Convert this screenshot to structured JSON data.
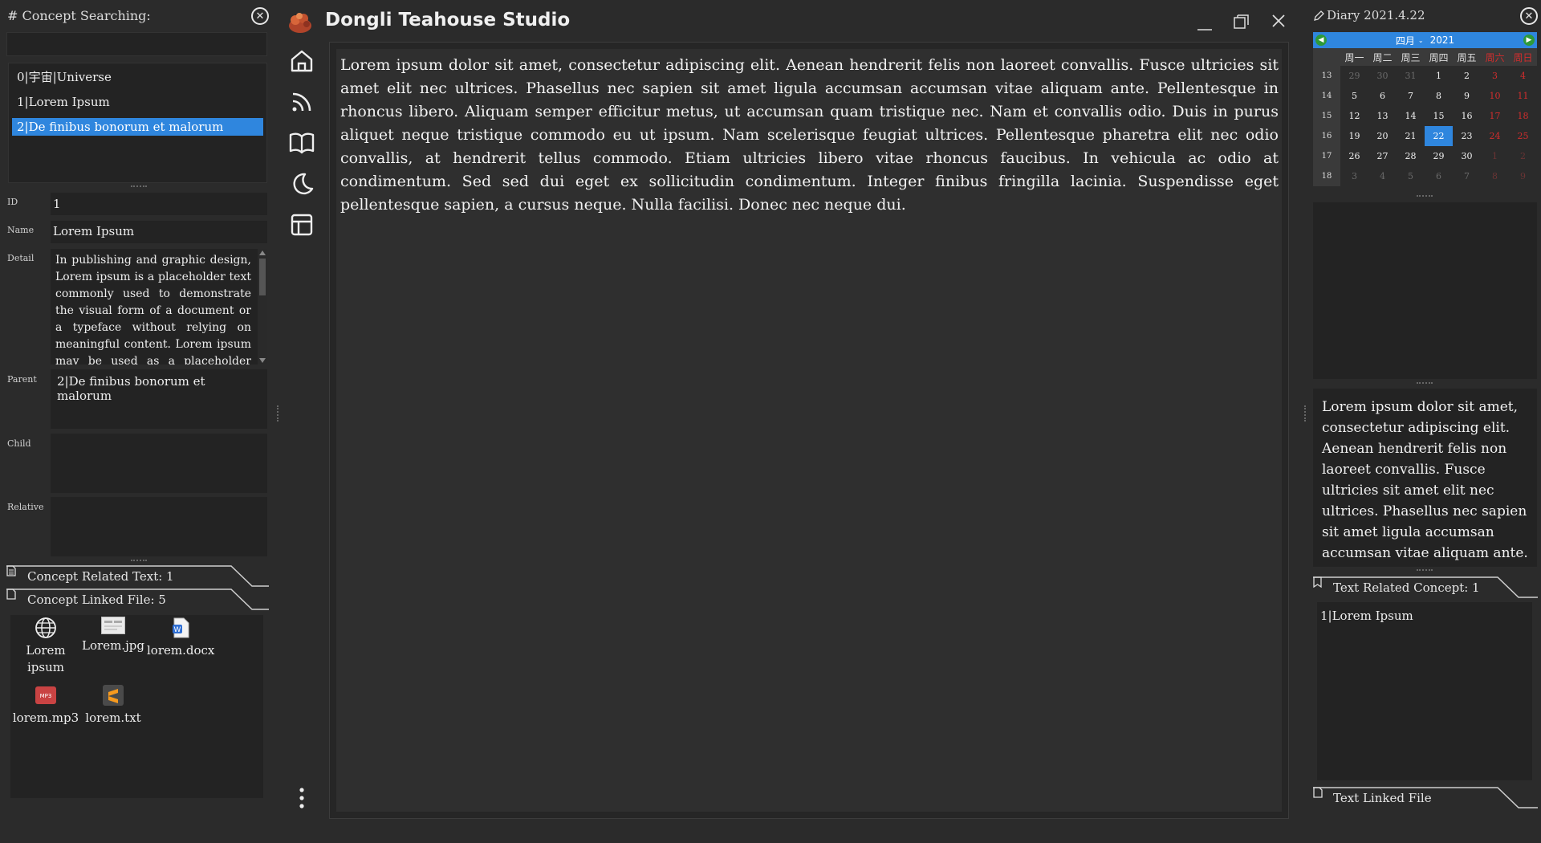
{
  "left_panel": {
    "title": "# Concept Searching:",
    "search_value": "",
    "concepts": [
      {
        "label": "0|宇宙|Universe",
        "selected": false
      },
      {
        "label": "1|Lorem Ipsum",
        "selected": false
      },
      {
        "label": "2|De finibus bonorum et malorum",
        "selected": true
      }
    ],
    "fields": {
      "id_label": "ID",
      "id_value": "1",
      "name_label": "Name",
      "name_value": "Lorem Ipsum",
      "detail_label": "Detail",
      "detail_value": "In publishing and graphic design, Lorem ipsum is a placeholder text commonly used to demonstrate the visual form of a document or a typeface without relying on meaningful content. Lorem ipsum may be used as a placeholder before final copy is available.",
      "parent_label": "Parent",
      "parent_value": "2|De finibus bonorum et malorum",
      "child_label": "Child",
      "child_value": "",
      "relative_label": "Relative",
      "relative_value": ""
    },
    "related_text_tab": "Concept Related Text: 1",
    "linked_file_tab": "Concept Linked File: 5",
    "files": [
      {
        "name": "Lorem ipsum",
        "icon": "globe-icon"
      },
      {
        "name": "Lorem.jpg",
        "icon": "image-icon"
      },
      {
        "name": "lorem.docx",
        "icon": "word-doc-icon"
      },
      {
        "name": "lorem.mp3",
        "icon": "mp3-icon"
      },
      {
        "name": "lorem.txt",
        "icon": "sublime-text-icon"
      }
    ]
  },
  "app": {
    "title": "Dongli Teahouse Studio",
    "logo_icon": "teahouse-logo-icon",
    "window_buttons": [
      "minimize-icon",
      "restore-icon",
      "close-icon"
    ],
    "nav_icons": [
      "home-icon",
      "rss-icon",
      "book-icon",
      "moon-icon",
      "layout-icon"
    ],
    "more_icon": "more-vertical-icon"
  },
  "editor": {
    "text": "Lorem ipsum dolor sit amet, consectetur adipiscing elit. Aenean hendrerit felis non laoreet convallis. Fusce ultricies sit amet elit nec ultrices. Phasellus nec sapien sit amet ligula accumsan accumsan vitae aliquam ante. Pellentesque in rhoncus libero. Aliquam semper efficitur metus, ut accumsan quam tristique nec. Nam et convallis odio. Duis in purus aliquet neque tristique commodo eu ut ipsum. Nam scelerisque feugiat ultrices. Pellentesque pharetra elit nec odio convallis, at hendrerit tellus commodo. Etiam ultricies libero vitae rhoncus faucibus. In vehicula ac odio at condimentum. Sed sed dui eget ex sollicitudin condimentum. Integer finibus fringilla lacinia. Suspendisse eget pellentesque sapien, a cursus neque. Nulla facilisi. Donec nec neque dui."
  },
  "right_panel": {
    "title": "Diary 2021.4.22",
    "calendar": {
      "month": "四月",
      "year": "2021",
      "weekdays": [
        "周一",
        "周二",
        "周三",
        "周四",
        "周五",
        "周六",
        "周日"
      ],
      "weeks": [
        {
          "week": "13",
          "days": [
            "29",
            "30",
            "31",
            "1",
            "2",
            "3",
            "4"
          ]
        },
        {
          "week": "14",
          "days": [
            "5",
            "6",
            "7",
            "8",
            "9",
            "10",
            "11"
          ]
        },
        {
          "week": "15",
          "days": [
            "12",
            "13",
            "14",
            "15",
            "16",
            "17",
            "18"
          ]
        },
        {
          "week": "16",
          "days": [
            "19",
            "20",
            "21",
            "22",
            "23",
            "24",
            "25"
          ]
        },
        {
          "week": "17",
          "days": [
            "26",
            "27",
            "28",
            "29",
            "30",
            "1",
            "2"
          ]
        },
        {
          "week": "18",
          "days": [
            "3",
            "4",
            "5",
            "6",
            "7",
            "8",
            "9"
          ]
        }
      ],
      "today": "22",
      "accent_color": "#2f86de",
      "weekend_color": "#d12d2d"
    },
    "note_text": "Lorem ipsum dolor sit amet, consectetur adipiscing elit. Aenean hendrerit felis non laoreet convallis. Fusce ultricies sit amet elit nec ultrices. Phasellus nec sapien sit amet ligula accumsan accumsan vitae aliquam ante.",
    "related_concept_tab": "Text Related Concept: 1",
    "related_concepts": [
      "1|Lorem Ipsum"
    ],
    "linked_file_tab": "Text Linked File"
  }
}
